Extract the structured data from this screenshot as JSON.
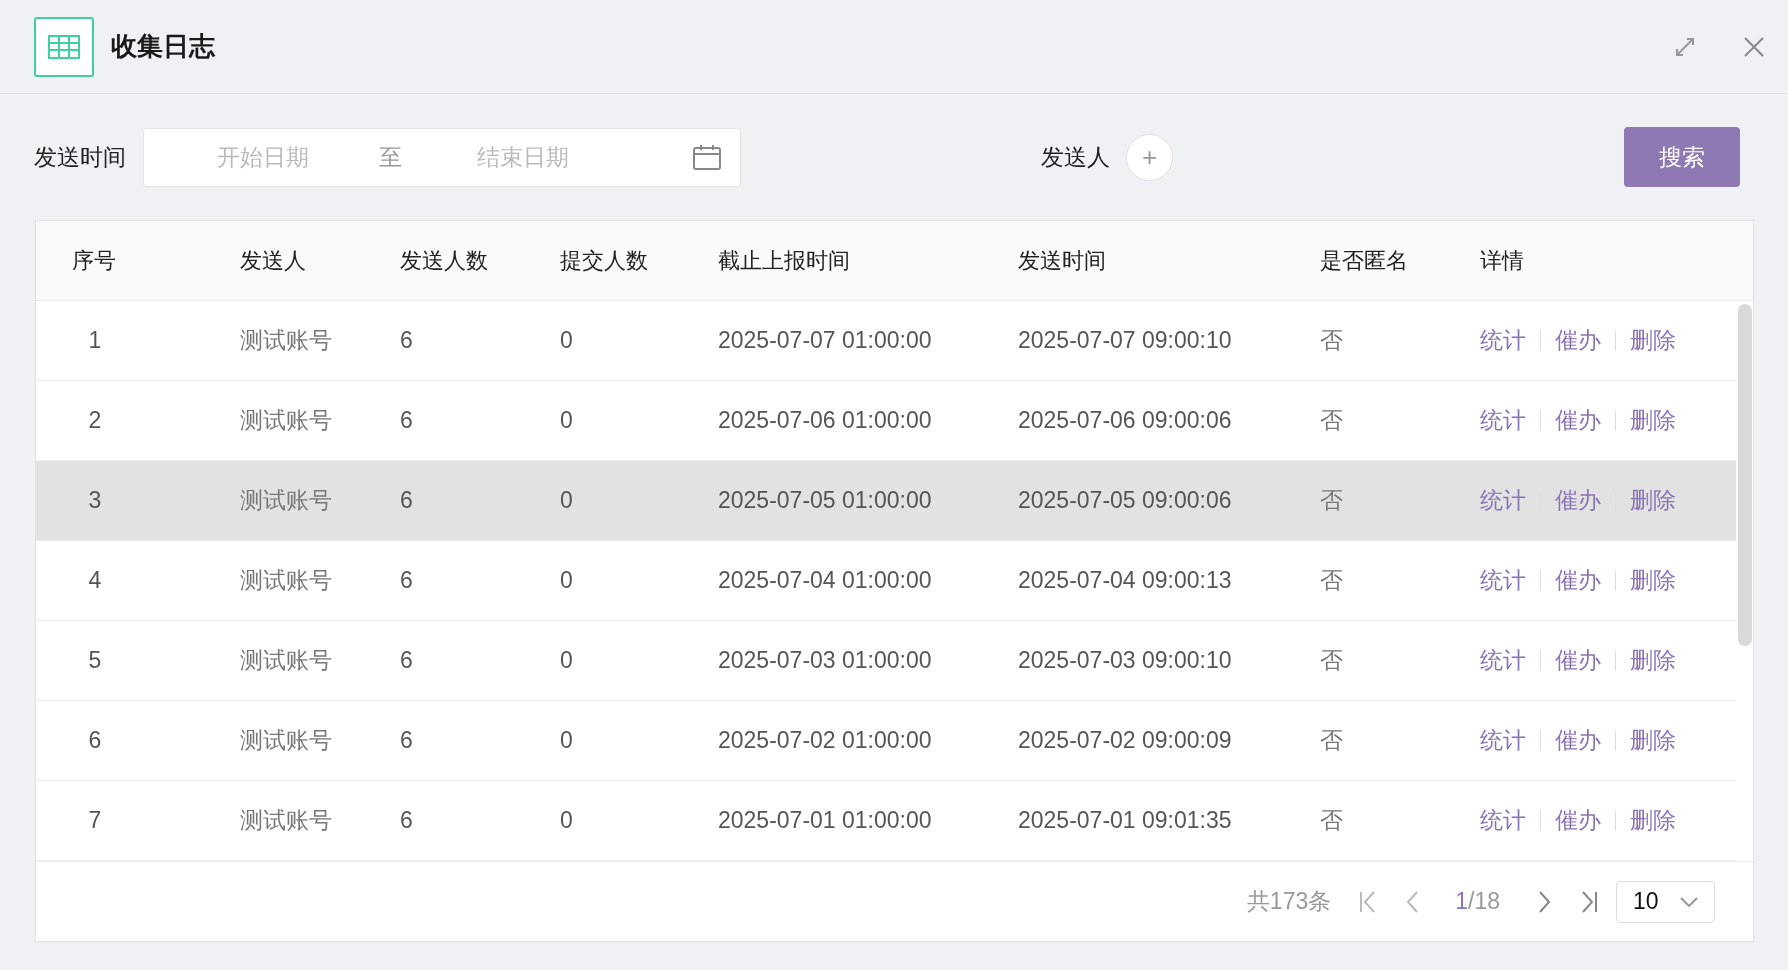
{
  "window": {
    "title": "收集日志"
  },
  "filters": {
    "time_label": "发送时间",
    "start_placeholder": "开始日期",
    "range_separator": "至",
    "end_placeholder": "结束日期",
    "sender_label": "发送人",
    "add_symbol": "+",
    "search_button": "搜索"
  },
  "table": {
    "columns": [
      "序号",
      "发送人",
      "发送人数",
      "提交人数",
      "截止上报时间",
      "发送时间",
      "是否匿名",
      "详情"
    ],
    "rows": [
      {
        "index": "1",
        "sender": "测试账号",
        "sent_count": "6",
        "submitted_count": "0",
        "deadline": "2025-07-07 01:00:00",
        "sent_time": "2025-07-07 09:00:10",
        "anonymous": "否",
        "actions": [
          "统计",
          "催办",
          "删除"
        ],
        "highlighted": false
      },
      {
        "index": "2",
        "sender": "测试账号",
        "sent_count": "6",
        "submitted_count": "0",
        "deadline": "2025-07-06 01:00:00",
        "sent_time": "2025-07-06 09:00:06",
        "anonymous": "否",
        "actions": [
          "统计",
          "催办",
          "删除"
        ],
        "highlighted": false
      },
      {
        "index": "3",
        "sender": "测试账号",
        "sent_count": "6",
        "submitted_count": "0",
        "deadline": "2025-07-05 01:00:00",
        "sent_time": "2025-07-05 09:00:06",
        "anonymous": "否",
        "actions": [
          "统计",
          "催办",
          "删除"
        ],
        "highlighted": true
      },
      {
        "index": "4",
        "sender": "测试账号",
        "sent_count": "6",
        "submitted_count": "0",
        "deadline": "2025-07-04 01:00:00",
        "sent_time": "2025-07-04 09:00:13",
        "anonymous": "否",
        "actions": [
          "统计",
          "催办",
          "删除"
        ],
        "highlighted": false
      },
      {
        "index": "5",
        "sender": "测试账号",
        "sent_count": "6",
        "submitted_count": "0",
        "deadline": "2025-07-03 01:00:00",
        "sent_time": "2025-07-03 09:00:10",
        "anonymous": "否",
        "actions": [
          "统计",
          "催办",
          "删除"
        ],
        "highlighted": false
      },
      {
        "index": "6",
        "sender": "测试账号",
        "sent_count": "6",
        "submitted_count": "0",
        "deadline": "2025-07-02 01:00:00",
        "sent_time": "2025-07-02 09:00:09",
        "anonymous": "否",
        "actions": [
          "统计",
          "催办",
          "删除"
        ],
        "highlighted": false
      },
      {
        "index": "7",
        "sender": "测试账号",
        "sent_count": "6",
        "submitted_count": "0",
        "deadline": "2025-07-01 01:00:00",
        "sent_time": "2025-07-01 09:01:35",
        "anonymous": "否",
        "actions": [
          "统计",
          "催办",
          "删除"
        ],
        "highlighted": false
      }
    ]
  },
  "pagination": {
    "total": "共173条",
    "current_page": "1",
    "page_total": "/18",
    "page_size": "10"
  }
}
